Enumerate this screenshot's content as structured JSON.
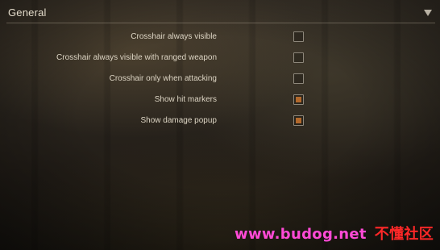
{
  "section": {
    "title": "General",
    "collapse_icon": "chevron-down-icon"
  },
  "options": [
    {
      "label": "Crosshair always visible",
      "checked": false
    },
    {
      "label": "Crosshair always visible with ranged weapon",
      "checked": false
    },
    {
      "label": "Crosshair only when attacking",
      "checked": false
    },
    {
      "label": "Show hit markers",
      "checked": true
    },
    {
      "label": "Show damage popup",
      "checked": true
    }
  ],
  "watermark": {
    "url": "www.budog.net",
    "site_name": "不懂社区"
  },
  "colors": {
    "checkbox_fill": "#b2692c",
    "label_text": "#ddd5c4",
    "watermark_url": "#ff4ad6",
    "watermark_site": "#ff2828"
  }
}
